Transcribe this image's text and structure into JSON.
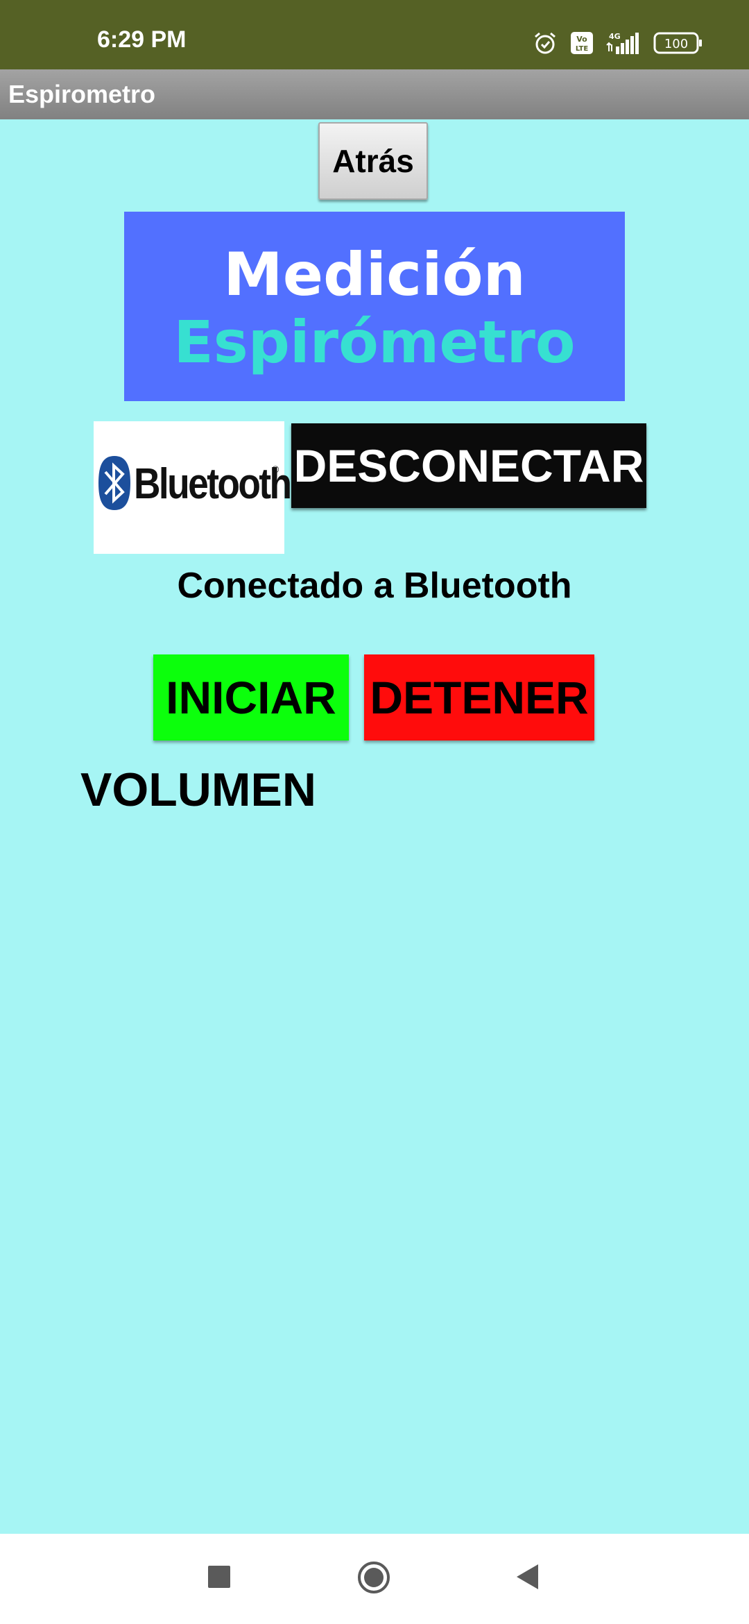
{
  "status_bar": {
    "time": "6:29 PM",
    "volte_label": "Vo\nLTE",
    "network_label": "4G",
    "battery_level": "100",
    "icons": [
      "alarm-icon",
      "volte-icon",
      "signal-icon",
      "battery-icon"
    ]
  },
  "app": {
    "title": "Espirometro"
  },
  "buttons": {
    "back": "Atrás",
    "disconnect": "DESCONECTAR",
    "start": "INICIAR",
    "stop": "DETENER"
  },
  "header": {
    "line1": "Medición",
    "line2": "Espirómetro"
  },
  "bluetooth_logo": {
    "word": "Bluetooth",
    "reg": "®"
  },
  "connection_status": "Conectado a Bluetooth",
  "volume_label": "VOLUMEN",
  "colors": {
    "background": "#a6f5f4",
    "status_bar": "#556125",
    "title_box": "#5270ff",
    "title_line2": "#37e0d1",
    "start": "#0cff0c",
    "stop": "#ff0c0c",
    "disconnect": "#0b0b0b"
  },
  "navigation": {
    "icons": [
      "recent-apps-icon",
      "home-icon",
      "back-icon"
    ]
  }
}
